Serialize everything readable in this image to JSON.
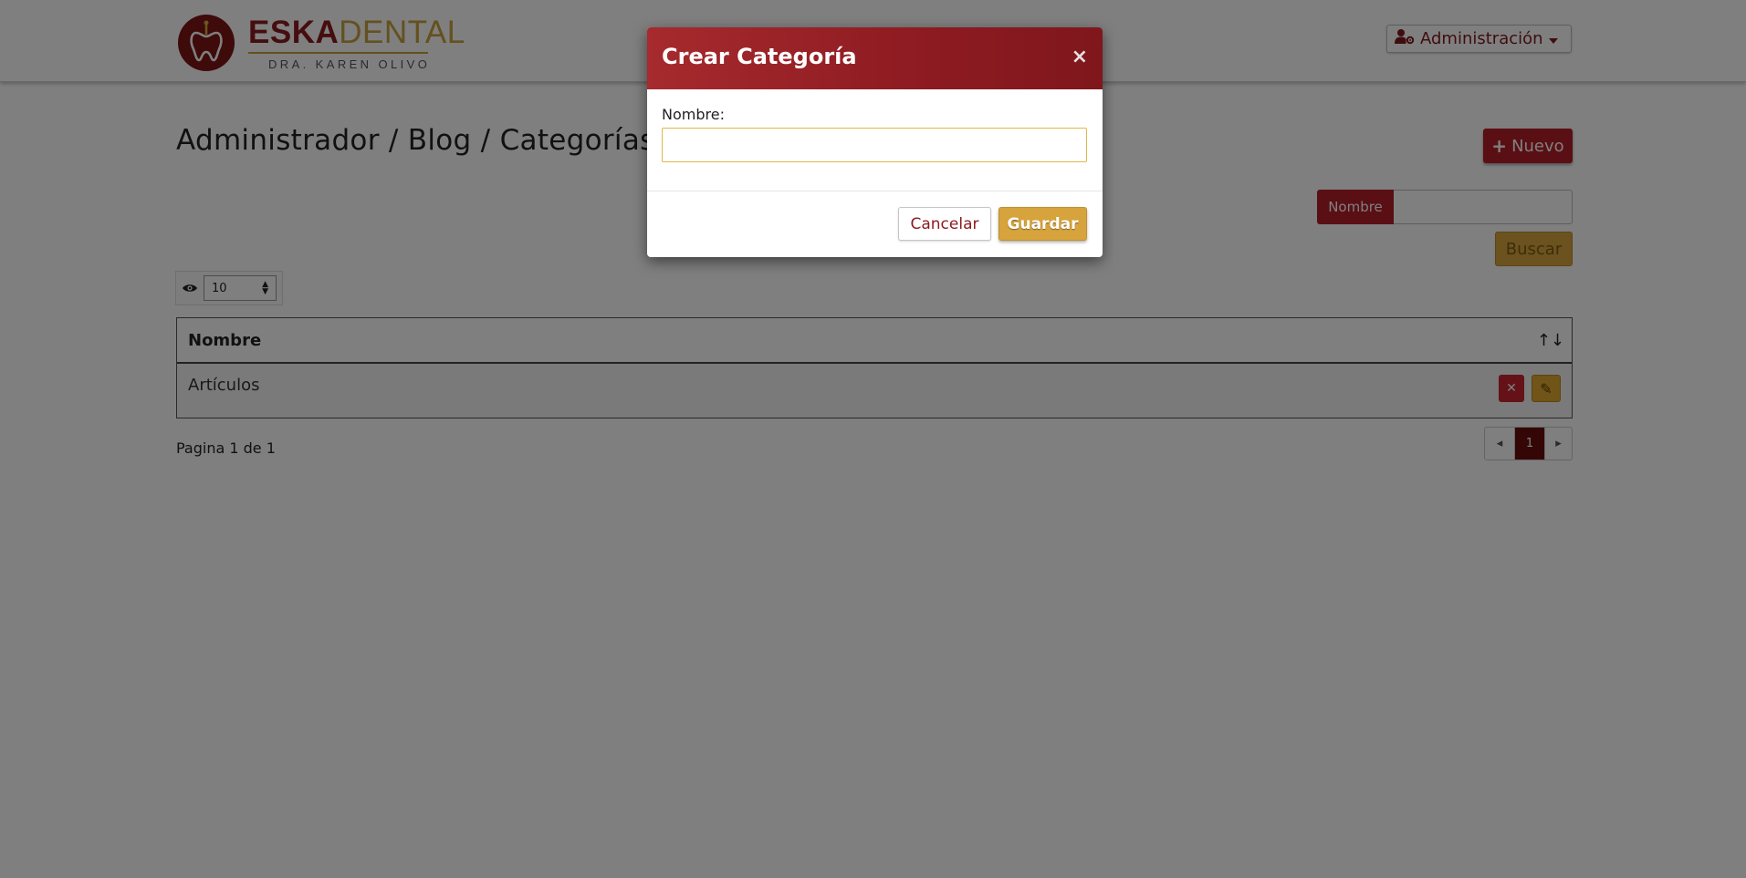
{
  "brand": {
    "name_part1": "ESKA",
    "name_part2": "DENTAL",
    "subtitle": "DRA. KAREN OLIVO",
    "primary_color": "#8c1a1e",
    "accent_color": "#c9a33d"
  },
  "header": {
    "admin_menu_label": "Administración",
    "admin_icon": "user-gear-icon"
  },
  "page": {
    "title": "Administrador / Blog / Categorías",
    "new_button_label": "Nuevo",
    "filter_label": "Nombre",
    "filter_value": "",
    "search_button_label": "Buscar",
    "page_size_value": "10"
  },
  "table": {
    "columns": [
      "Nombre"
    ],
    "rows": [
      {
        "name": "Artículos"
      }
    ]
  },
  "pagination": {
    "summary": "Pagina 1 de 1",
    "current_page": "1"
  },
  "modal": {
    "title": "Crear Categoría",
    "close_glyph": "×",
    "field_label": "Nombre:",
    "field_value": "",
    "cancel_label": "Cancelar",
    "save_label": "Guardar"
  }
}
